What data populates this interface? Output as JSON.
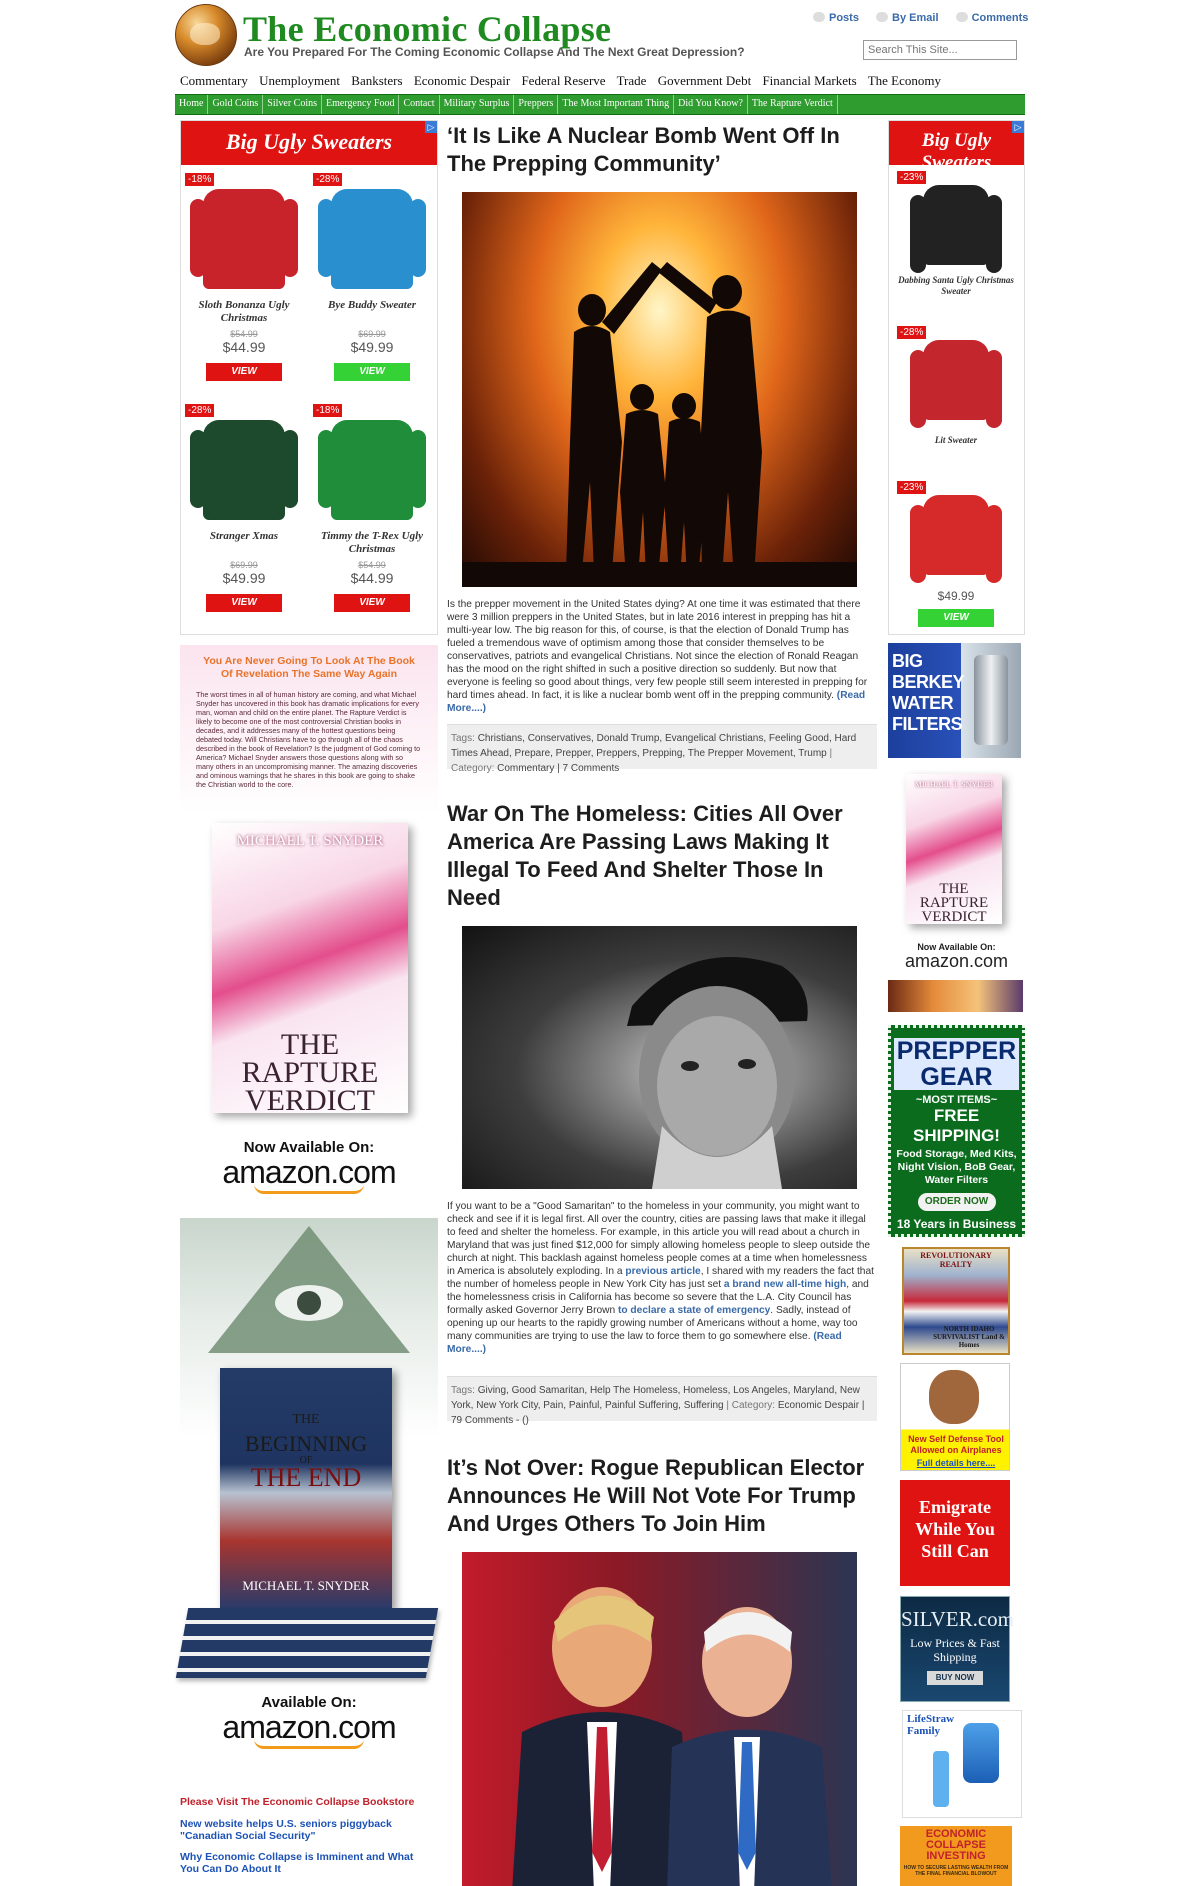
{
  "header": {
    "site_title": "The Economic Collapse",
    "tagline": "Are You Prepared For The Coming Economic Collapse And The Next Great Depression?",
    "links": [
      "Posts",
      "By Email",
      "Comments"
    ],
    "search_placeholder": "Search This Site..."
  },
  "category_nav": [
    "Commentary",
    "Unemployment",
    "Banksters",
    "Economic Despair",
    "Federal Reserve",
    "Trade",
    "Government Debt",
    "Financial Markets",
    "The Economy"
  ],
  "main_nav": [
    "Home",
    "Gold Coins",
    "Silver Coins",
    "Emergency Food",
    "Contact",
    "Military Surplus",
    "Preppers",
    "The Most Important Thing",
    "Did You Know?",
    "The Rapture Verdict"
  ],
  "left_ad": {
    "heading": "Big Ugly Sweaters",
    "items": [
      {
        "discount": "-18%",
        "name": "Sloth Bonanza Ugly Christmas",
        "old_price": "$54.99",
        "price": "$44.99",
        "button": "VIEW",
        "color": "#c8222b"
      },
      {
        "discount": "-28%",
        "name": "Bye Buddy Sweater",
        "old_price": "$69.99",
        "price": "$49.99",
        "button": "VIEW",
        "color": "#2a8fcf"
      },
      {
        "discount": "-28%",
        "name": "Stranger Xmas",
        "old_price": "$69.99",
        "price": "$49.99",
        "button": "VIEW",
        "color": "#1d4a2c"
      },
      {
        "discount": "-18%",
        "name": "Timmy the T-Rex Ugly Christmas",
        "old_price": "$54.99",
        "price": "$44.99",
        "button": "VIEW",
        "color": "#1f8d3a"
      }
    ]
  },
  "right_ad": {
    "heading": "Big Ugly Sweaters",
    "items": [
      {
        "discount": "-23%",
        "name": "Dabbing Santa Ugly Christmas Sweater",
        "color": "#222"
      },
      {
        "discount": "-28%",
        "name": "Lit Sweater",
        "color": "#c4262e"
      },
      {
        "discount": "-23%",
        "name": "",
        "color": "#d62a2a"
      }
    ],
    "price": "$49.99",
    "button": "VIEW"
  },
  "left_sidebar": {
    "promo_heading": "You Are Never Going To Look At The Book Of Revelation The Same Way Again",
    "promo_text": "The worst times in all of human history are coming, and what Michael Snyder has uncovered in this book has dramatic implications for every man, woman and child on the entire planet. The Rapture Verdict is likely to become one of the most controversial Christian books in decades, and it addresses many of the hottest questions being debated today. Will Christians have to go through all of the chaos described in the book of Revelation? Is the judgment of God coming to America? Michael Snyder answers those questions along with so many others in an uncompromising manner. The amazing discoveries and ominous warnings that he shares in this book are going to shake the Christian world to the core.",
    "book1_author": "MICHAEL T. SNYDER",
    "book1_title": "THE RAPTURE VERDICT",
    "book1_available": "Now Available On:",
    "amazon": "amazon.com",
    "book2_title_line1": "THE",
    "book2_title_line2": "BEGINNING",
    "book2_title_line3": "OF",
    "book2_title_line4": "THE END",
    "book2_author": "MICHAEL T. SNYDER",
    "book2_available": "Available On:",
    "links": [
      {
        "text": "Please Visit The Economic Collapse Bookstore",
        "color": "#c0212b"
      },
      {
        "text": "New website helps U.S. seniors piggyback \"Canadian Social Security\"",
        "color": "#1c52b5"
      },
      {
        "text": "Why Economic Collapse is Imminent and What You Can Do About It",
        "color": "#1c52b5"
      }
    ]
  },
  "right_sidebar": {
    "berkey": "BIG BERKEY WATER FILTERS",
    "rv_book_author": "MICHAEL T. SNYDER",
    "rv_book_title": "THE RAPTURE VERDICT",
    "rv_available": "Now Available On:",
    "amazon": "amazon.com",
    "prepper_gear": "PREPPER GEAR",
    "most_items": "~MOST ITEMS~",
    "free_shipping": "FREE SHIPPING!",
    "prepper_desc": "Food Storage, Med Kits, Night Vision, BoB Gear, Water Filters",
    "order_now": "ORDER NOW",
    "years": "18 Years in Business",
    "realty_top": "REVOLUTIONARY REALTY",
    "realty_bottom": "NORTH IDAHO SURVIVALIST Land & Homes",
    "self_defense": "New Self Defense Tool Allowed on Airplanes",
    "self_defense_link": "Full details here....",
    "emigrate": "Emigrate While You Still Can",
    "silver": "SILVER.com",
    "silver_sub": "Low Prices & Fast Shipping",
    "silver_btn": "BUY NOW",
    "lifestraw": "LifeStraw Family",
    "eci_title": "ECONOMIC COLLAPSE INVESTING",
    "eci_sub": "HOW TO SECURE LASTING WEALTH FROM THE FINAL FINANCIAL BLOWOUT"
  },
  "posts": [
    {
      "title": "‘It Is Like A Nuclear Bomb Went Off In The Prepping Community’",
      "excerpt": "Is the prepper movement in the United States dying?  At one time it was estimated that there were 3 million preppers in the United States, but in late 2016 interest in prepping has hit a multi-year low.  The big reason for this, of course, is that the election of Donald Trump has fueled a tremendous wave of optimism among those that consider themselves to be conservatives, patriots and evangelical Christians.  Not since the election of Ronald Reagan has the mood on the right shifted in such a positive direction so suddenly.  But now that everyone is feeling so good about things, very few people still seem interested in prepping for hard times ahead.  In fact, it is like a nuclear bomb went off in the prepping community.",
      "read_more": "(Read More....)",
      "tags_label": "Tags:",
      "tags": "Christians, Conservatives, Donald Trump, Evangelical Christians, Feeling Good, Hard Times Ahead, Prepare, Prepper, Preppers, Prepping, The Prepper Movement, Trump",
      "category_label": "| Category:",
      "category": "Commentary",
      "comments": "| 7 Comments"
    },
    {
      "title": "War On The Homeless: Cities All Over America Are Passing Laws Making It Illegal To Feed And Shelter Those In Need",
      "excerpt_1": "If you want to be a \"Good Samaritan\" to the homeless in your community, you might want to check and see if it is legal first.  All over the country, cities are passing laws that make it illegal to feed and shelter the homeless.  For example, in this article you will read about a church in Maryland that was just fined $12,000 for simply allowing homeless people to sleep outside the church at night.  This backlash against homeless people comes at a time when homelessness in America is absolutely exploding.  In a ",
      "link_1": "previous article",
      "excerpt_2": ", I shared with my readers the fact that the number of homeless people in New York City has just set ",
      "link_2": "a brand new all-time high",
      "excerpt_3": ", and the homelessness crisis in California has become so severe that the L.A. City Council has formally asked Governor Jerry Brown ",
      "link_3": "to declare a state of emergency",
      "excerpt_4": ".  Sadly, instead of opening up our hearts to the rapidly growing number of Americans without a home, way too many communities are trying to use the law to force them to go somewhere else. ",
      "read_more": "(Read More....)",
      "tags_label": "Tags:",
      "tags": "Giving, Good Samaritan, Help The Homeless, Homeless, Los Angeles, Maryland, New York, New York City, Pain, Painful, Painful Suffering, Suffering",
      "category_label": "| Category:",
      "category": "Economic Despair",
      "comments": "| 79 Comments - ()"
    },
    {
      "title": "It’s Not Over: Rogue Republican Elector Announces He Will Not Vote For Trump And Urges Others To Join Him"
    }
  ],
  "colors": {
    "brand_green": "#2e9c2e",
    "title_green": "#1f8a1f",
    "ad_red": "#e01313",
    "link_blue": "#3a6aa8"
  }
}
